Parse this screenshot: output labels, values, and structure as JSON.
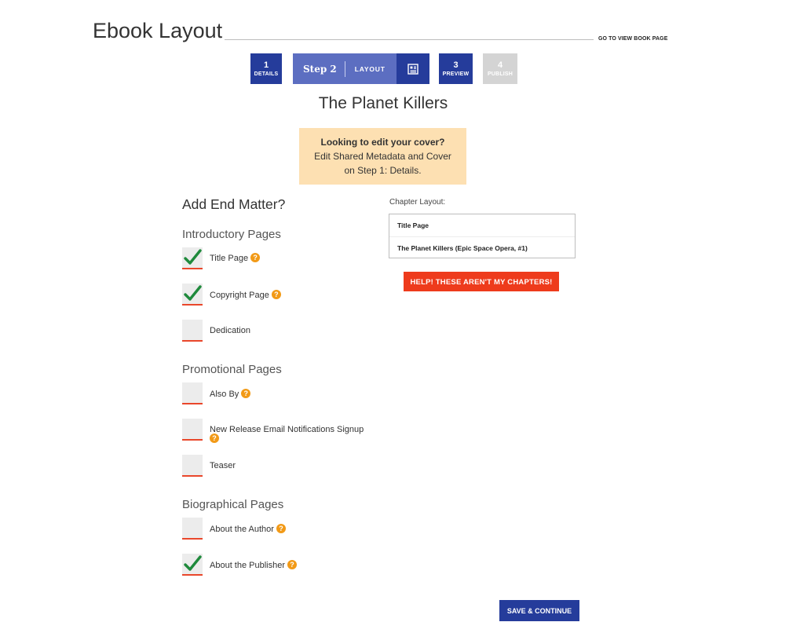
{
  "header": {
    "title": "Ebook Layout",
    "view_link": "GO TO VIEW BOOK PAGE"
  },
  "stepper": {
    "steps": [
      {
        "num": "1",
        "label": "DETAILS",
        "state": "done"
      },
      {
        "num": "Step 2",
        "label": "LAYOUT",
        "state": "current",
        "icon": "layout-icon"
      },
      {
        "num": "3",
        "label": "PREVIEW",
        "state": "done"
      },
      {
        "num": "4",
        "label": "PUBLISH",
        "state": "disabled"
      }
    ]
  },
  "book": {
    "title": "The Planet Killers"
  },
  "notice": {
    "heading": "Looking to edit your cover?",
    "line1": "Edit Shared Metadata and Cover",
    "line2": "on Step 1: Details."
  },
  "end_matter": {
    "title": "Add End Matter?",
    "sections": [
      {
        "heading": "Introductory Pages",
        "options": [
          {
            "label": "Title Page",
            "checked": true,
            "help": true
          },
          {
            "label": "Copyright Page",
            "checked": true,
            "help": true
          },
          {
            "label": "Dedication",
            "checked": false,
            "help": false
          }
        ]
      },
      {
        "heading": "Promotional Pages",
        "options": [
          {
            "label": "Also By",
            "checked": false,
            "help": true
          },
          {
            "label": "New Release Email Notifications Signup",
            "checked": false,
            "help": true
          },
          {
            "label": "Teaser",
            "checked": false,
            "help": false
          }
        ]
      },
      {
        "heading": "Biographical Pages",
        "options": [
          {
            "label": "About the Author",
            "checked": false,
            "help": true
          },
          {
            "label": "About the Publisher",
            "checked": true,
            "help": true
          }
        ]
      }
    ]
  },
  "chapter_layout": {
    "label": "Chapter Layout:",
    "items": [
      "Title Page",
      "The Planet Killers (Epic Space Opera, #1)"
    ]
  },
  "help_button": "HELP! THESE AREN'T MY CHAPTERS!",
  "save_button": "SAVE & CONTINUE",
  "help_glyph": "?",
  "colors": {
    "primary": "#253c9b",
    "current_step": "#5c6ec1",
    "accent_red": "#ee3b1c",
    "help_orange": "#f29a17",
    "check_green": "#1f8a3c",
    "notice_bg": "#fde0b2"
  }
}
